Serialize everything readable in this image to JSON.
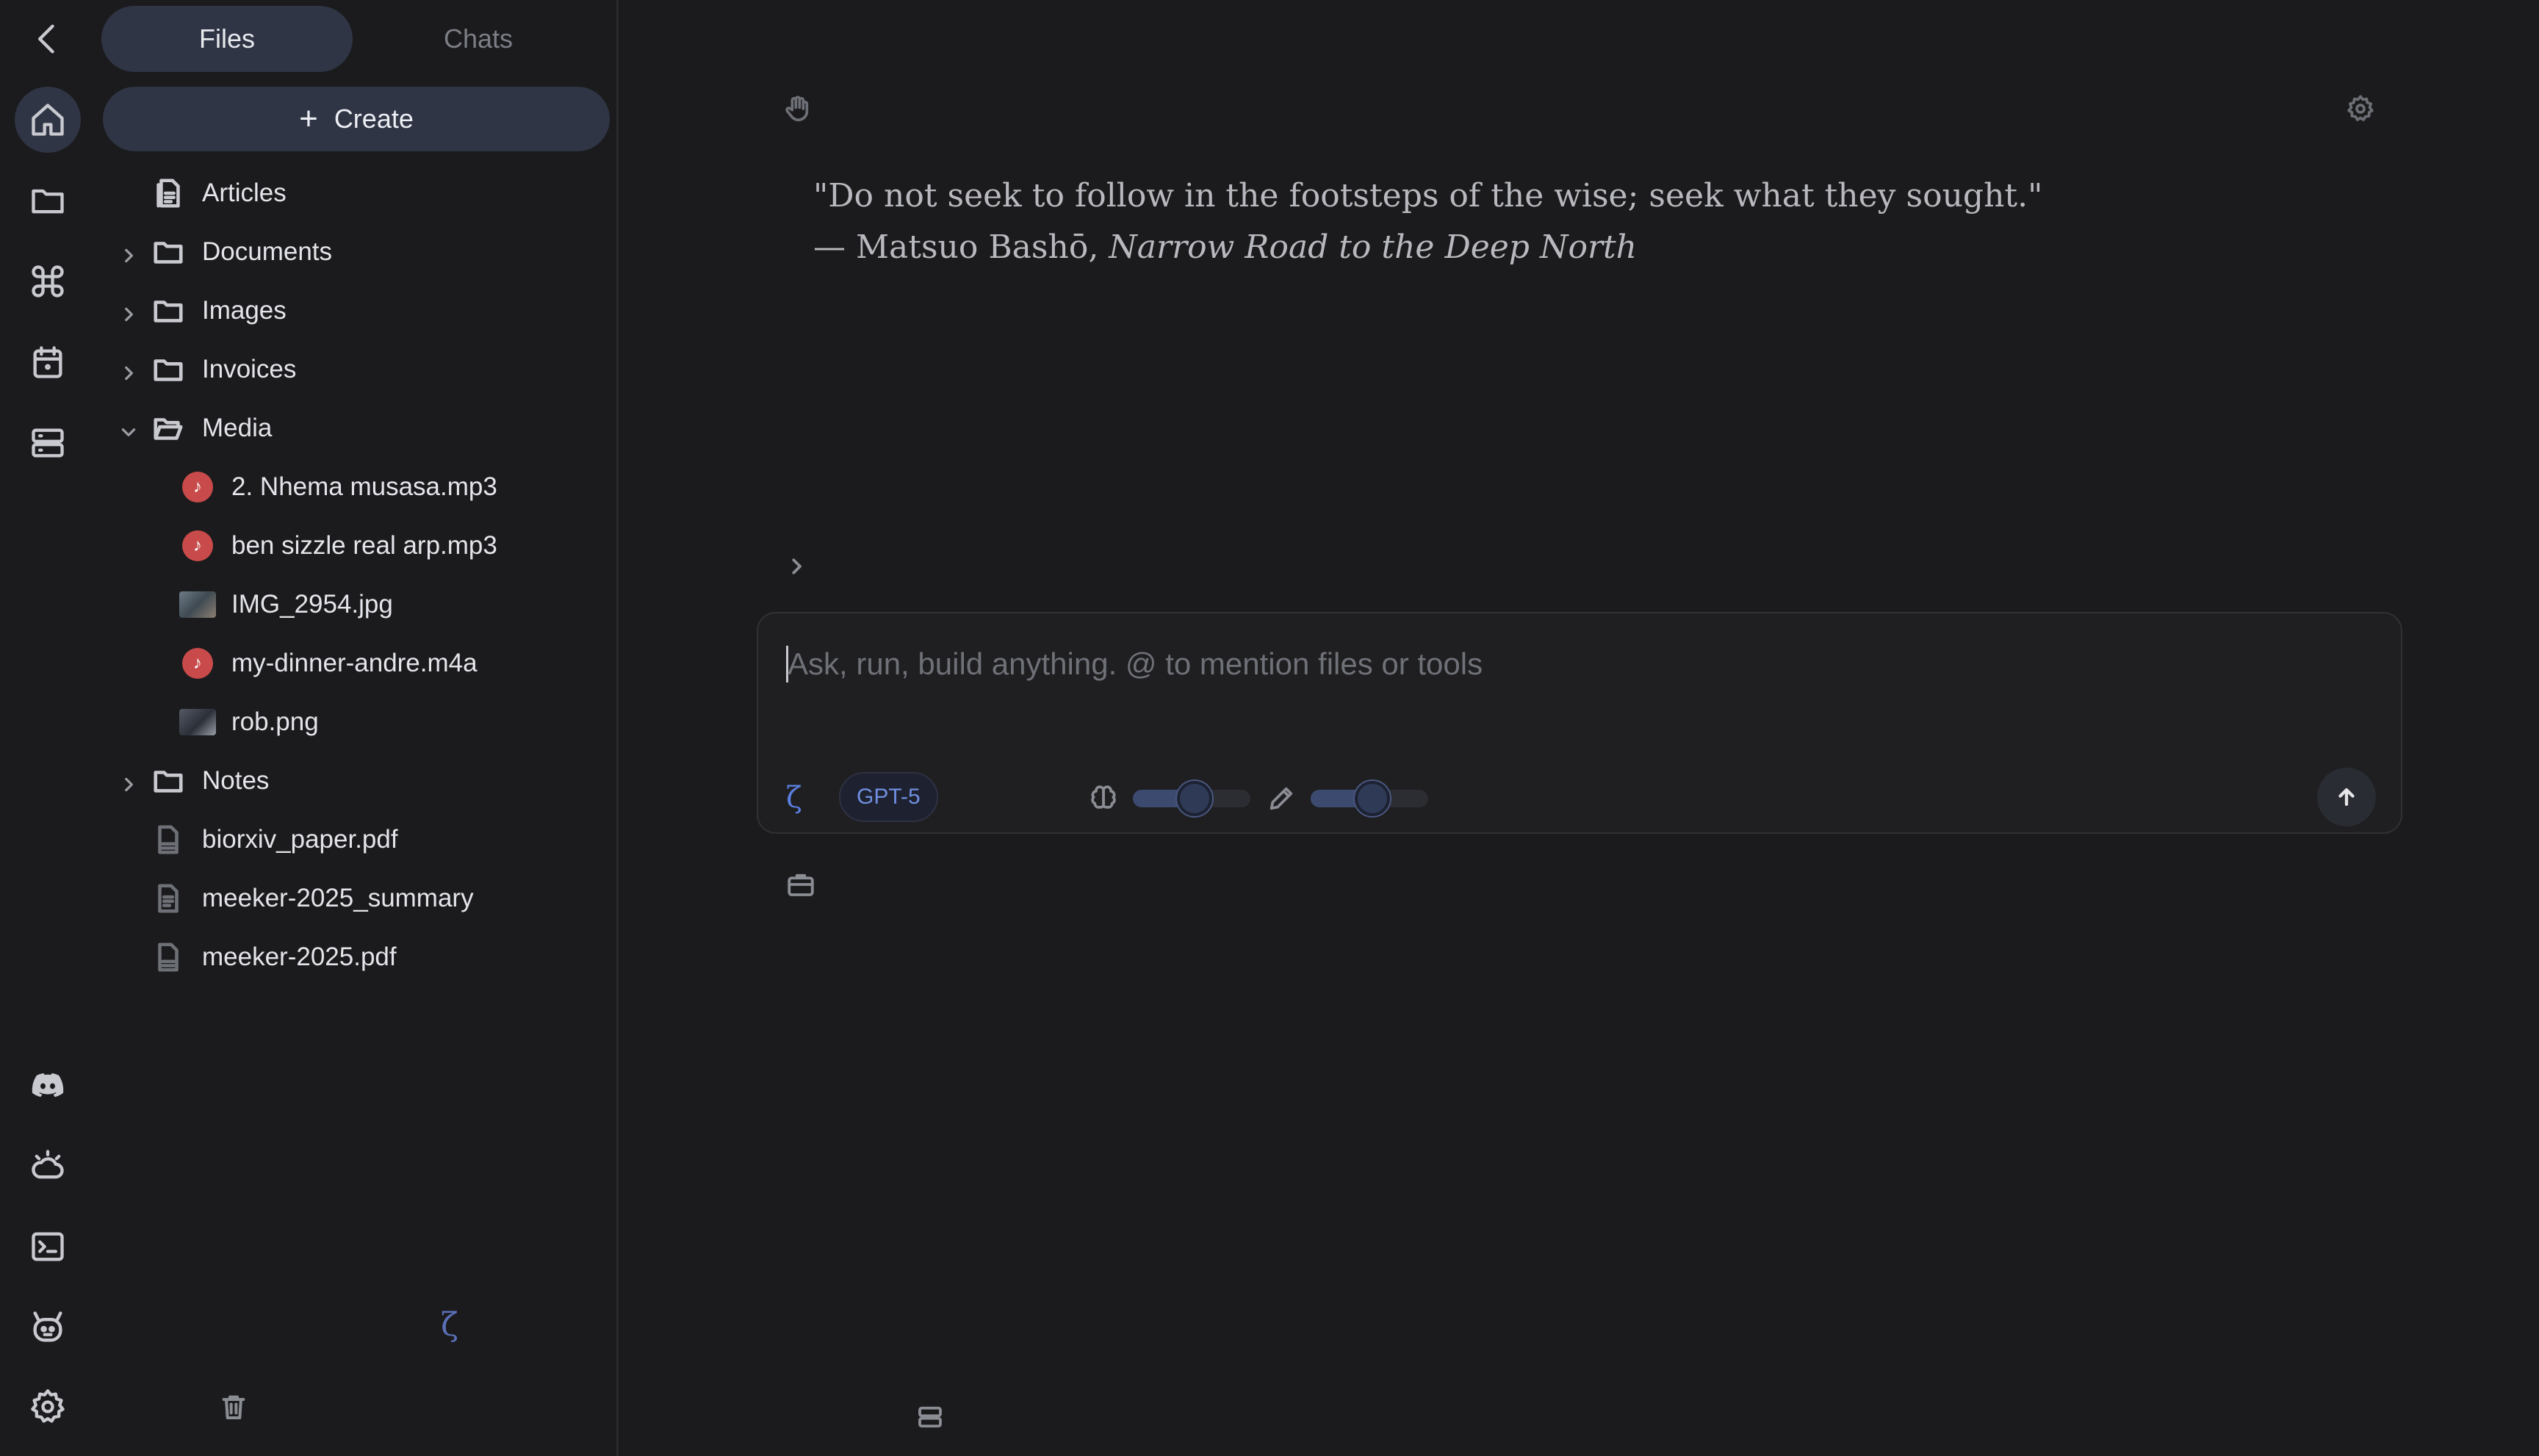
{
  "tabs": {
    "files": "Files",
    "chats": "Chats"
  },
  "create_label": "Create",
  "tree": {
    "articles": "Articles",
    "documents": "Documents",
    "images": "Images",
    "invoices": "Invoices",
    "media": "Media",
    "media_items": [
      "2. Nhema musasa.mp3",
      "ben sizzle real arp.mp3",
      "IMG_2954.jpg",
      "my-dinner-andre.m4a",
      "rob.png"
    ],
    "notes": "Notes",
    "files": [
      "biorxiv_paper.pdf",
      "meeker-2025_summary",
      "meeker-2025.pdf"
    ]
  },
  "quote": {
    "line1": "\"Do not seek to follow in the footsteps of the wise; seek what they sought.\"",
    "attribution": "— Matsuo Bashō, ",
    "work": "Narrow Road to the Deep North"
  },
  "composer": {
    "placeholder": "Ask, run, build anything. @ to mention files or tools",
    "model": "GPT-5",
    "reasoning_level": 0.5,
    "verbosity_level": 0.5,
    "zeta": "ζ"
  },
  "colors": {
    "accent": "#2f3545",
    "audio": "#c84a4a",
    "model_text": "#6f8fe0"
  }
}
